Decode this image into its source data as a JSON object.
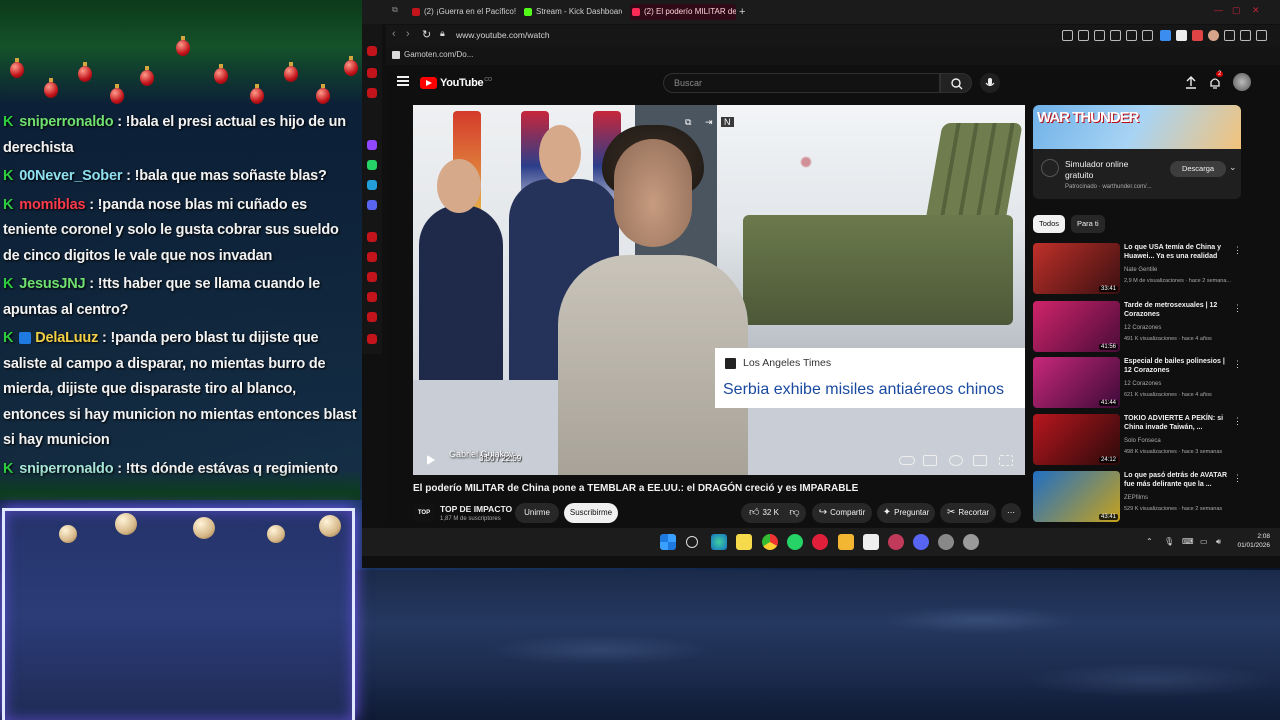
{
  "chat": {
    "messages": [
      {
        "user": "sniperronaldo",
        "user_class": "user-green",
        "text": ": !bala el presi actual es hijo de un derechista"
      },
      {
        "user": "00Never_Sober",
        "user_class": "user-cyan",
        "text": ": !bala que mas soñaste blas?"
      },
      {
        "user": "momiblas",
        "user_class": "user-red",
        "text": ": !panda nose blas mi cuñado es teniente coronel y solo le gusta cobrar sus sueldo de cinco digitos le vale que nos invadan"
      },
      {
        "user": "JesusJNJ",
        "user_class": "user-green",
        "text": ": !tts haber que se llama cuando le apuntas al centro?"
      },
      {
        "user": "DelaLuuz",
        "user_class": "user-yellow",
        "text": ": !panda pero blast tu dijiste que saliste al campo a disparar, no mientas burro de mierda, dijiste que disparaste tiro al blanco, entonces si hay municion no mientas entonces blast si hay municion"
      },
      {
        "user": "sniperronaldo",
        "user_class": "user-teal",
        "text": ": !tts dónde estávas q regimiento"
      }
    ]
  },
  "browser": {
    "tabs": [
      {
        "label": "(2) ¡Guerra en el Pacífico!",
        "color": "#c2141a"
      },
      {
        "label": "Stream - Kick Dashboard",
        "color": "#53fc18"
      },
      {
        "label": "(2) El poderío MILITAR de",
        "color": "#ff2a55"
      }
    ],
    "url": "www.youtube.com/watch",
    "bookmark": "Gamoten.com/Do..."
  },
  "youtube": {
    "logo_text": "YouTube",
    "logo_sup": "CO",
    "search_placeholder": "Buscar",
    "notification_count": "2",
    "video": {
      "news_source": "Los Angeles Times",
      "news_headline": "Serbia exhibe misiles antiaéreos chinos",
      "overlay_channel": "Gabriel Guiakov",
      "time": "3:50 / 22:59",
      "title": "El poderío MILITAR de China pone a TEMBLAR a EE.UU.: el DRAGÓN creció y es IMPARABLE",
      "channel_logo": "TOP",
      "channel_name": "TOP DE IMPACTO",
      "subscribers": "1,87 M de suscriptores",
      "join_label": "Unirme",
      "subscribe_label": "Suscribirme",
      "likes": "32 K",
      "share_label": "Compartir",
      "ask_label": "Preguntar",
      "clip_label": "Recortar"
    },
    "ad": {
      "banner_text": "WAR THUNDER",
      "title": "Simulador online gratuito",
      "sponsor": "Patrocinado · warthunder.com/...",
      "button": "Descarga"
    },
    "chips": [
      {
        "label": "Todos",
        "active": true
      },
      {
        "label": "Para ti",
        "active": false
      }
    ],
    "sidebar": [
      {
        "title": "Lo que USA temía de China y Huawei... Ya es una realidad",
        "channel": "Nate Gentile",
        "meta": "2,9 M de visualizaciones · hace 2 semana...",
        "duration": "33:41",
        "colors": [
          "#c0302a",
          "#3a1010"
        ]
      },
      {
        "title": "Tarde de metrosexuales | 12 Corazones",
        "channel": "12 Corazones",
        "meta": "491 K visualizaciones · hace 4 años",
        "duration": "41:56",
        "colors": [
          "#d0246a",
          "#4a0c3a"
        ]
      },
      {
        "title": "Especial de bailes polinesios | 12 Corazones",
        "channel": "12 Corazones",
        "meta": "621 K visualizaciones · hace 4 años",
        "duration": "41:44",
        "colors": [
          "#c8287a",
          "#3c0a38"
        ]
      },
      {
        "title": "TOKIO ADVIERTE A PEKÍN: si China invade Taiwán, ...",
        "channel": "Solo Fonseca",
        "meta": "498 K visualizaciones · hace 3 semanas",
        "duration": "24:12",
        "colors": [
          "#b8161e",
          "#2a0a0a"
        ]
      },
      {
        "title": "Lo que pasó detrás de AVATAR fue más delirante que la ...",
        "channel": "ZEPfilms",
        "meta": "529 K visualizaciones · hace 2 semanas",
        "duration": "43:41",
        "colors": [
          "#1f6fc4",
          "#c7a21c"
        ]
      }
    ]
  },
  "taskbar": {
    "time": "2:08",
    "date": "01/01/2026"
  }
}
